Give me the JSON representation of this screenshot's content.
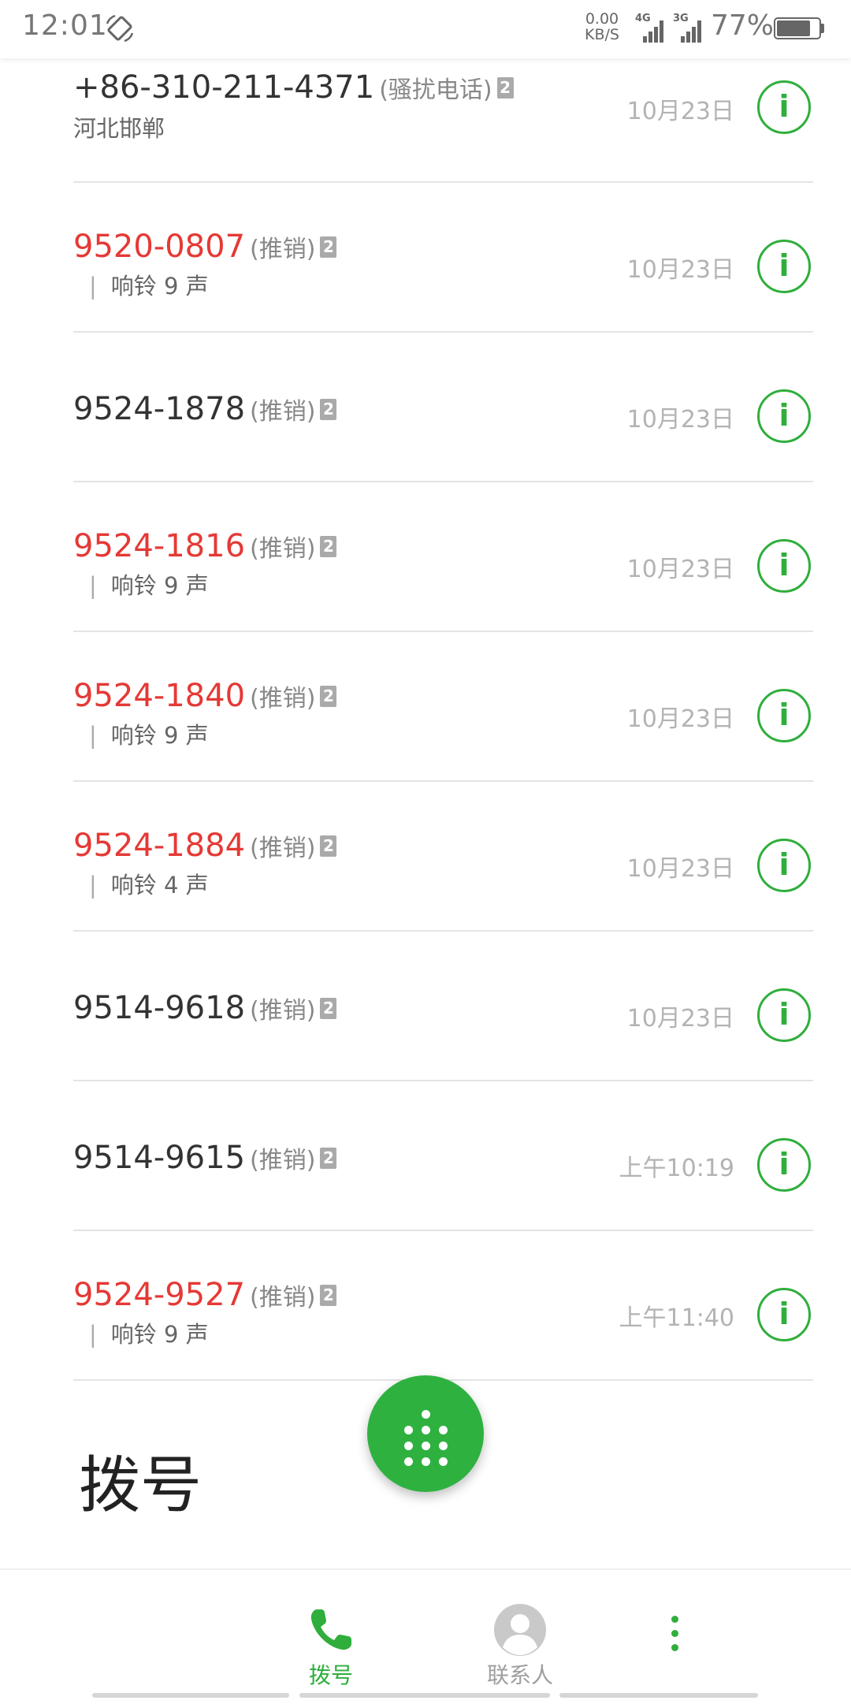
{
  "status_bar": {
    "time": "12:01",
    "net_speed_value": "0.00",
    "net_speed_unit": "KB/S",
    "signal1_label": "4G",
    "signal2_label": "3G",
    "battery_percent": "77%",
    "icons": [
      "rotate-icon",
      "signal-icon",
      "battery-icon"
    ]
  },
  "call_log": [
    {
      "number": "+86-310-211-4371",
      "tag": "(骚扰电话)",
      "sim": "2",
      "sub": "河北邯郸",
      "date": "10月23日",
      "missed": false
    },
    {
      "number": "9520-0807",
      "tag": "(推销)",
      "sim": "2",
      "sub": "响铃 9 声",
      "date": "10月23日",
      "missed": true
    },
    {
      "number": "9524-1878",
      "tag": "(推销)",
      "sim": "2",
      "sub": "",
      "date": "10月23日",
      "missed": false
    },
    {
      "number": "9524-1816",
      "tag": "(推销)",
      "sim": "2",
      "sub": "响铃 9 声",
      "date": "10月23日",
      "missed": true
    },
    {
      "number": "9524-1840",
      "tag": "(推销)",
      "sim": "2",
      "sub": "响铃 9 声",
      "date": "10月23日",
      "missed": true
    },
    {
      "number": "9524-1884",
      "tag": "(推销)",
      "sim": "2",
      "sub": "响铃 4 声",
      "date": "10月23日",
      "missed": true
    },
    {
      "number": "9514-9618",
      "tag": "(推销)",
      "sim": "2",
      "sub": "",
      "date": "10月23日",
      "missed": false
    },
    {
      "number": "9514-9615",
      "tag": "(推销)",
      "sim": "2",
      "sub": "",
      "date": "上午10:19",
      "missed": false
    },
    {
      "number": "9524-9527",
      "tag": "(推销)",
      "sim": "2",
      "sub": "响铃 9 声",
      "date": "上午11:40",
      "missed": true
    }
  ],
  "info_icon_glyph": "i",
  "sub_separator": "|",
  "title": "拨号",
  "fab_icon": "dialpad-icon",
  "bottom_nav": {
    "items": [
      {
        "label": "拨号",
        "icon": "phone-icon",
        "active": true
      },
      {
        "label": "联系人",
        "icon": "contact-avatar-icon",
        "active": false
      }
    ],
    "more_icon": "more-vertical-icon"
  },
  "colors": {
    "accent": "#2fae3c",
    "missed": "#e53935",
    "normal_number": "#333333",
    "secondary": "#888888"
  }
}
